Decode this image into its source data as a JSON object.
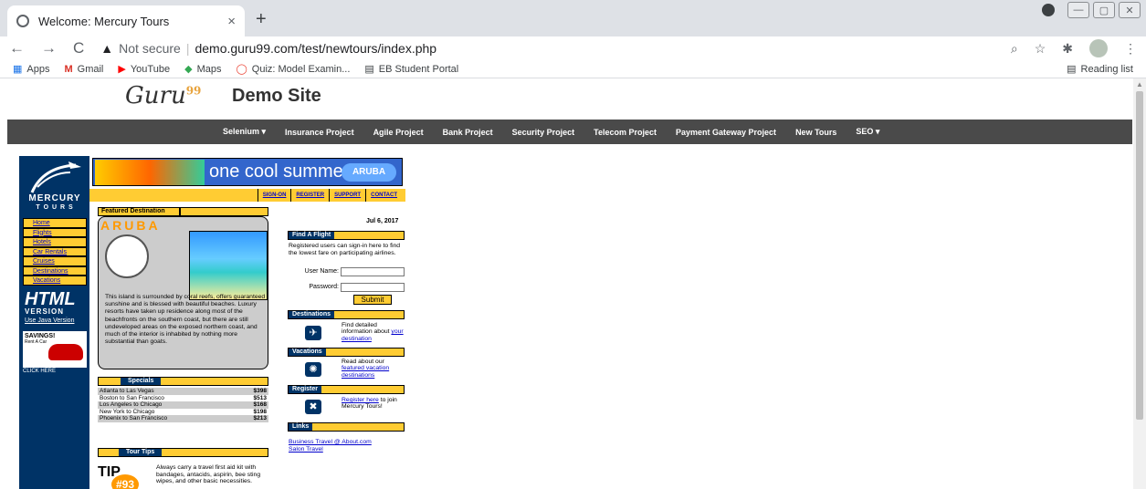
{
  "browser": {
    "tab_title": "Welcome: Mercury Tours",
    "tab_close": "×",
    "new_tab": "+",
    "address": {
      "not_secure": "Not secure",
      "separator": "|",
      "url": "demo.guru99.com/test/newtours/index.php"
    },
    "bookmarks": [
      "Apps",
      "Gmail",
      "YouTube",
      "Maps",
      "Quiz: Model Examin...",
      "EB Student Portal"
    ],
    "reading_list": "Reading list"
  },
  "site": {
    "logo": "Guru",
    "logo_sup": "99",
    "title": "Demo Site",
    "menu": [
      "Selenium ▾",
      "Insurance Project",
      "Agile Project",
      "Bank Project",
      "Security Project",
      "Telecom Project",
      "Payment Gateway Project",
      "New Tours",
      "SEO ▾"
    ]
  },
  "mercury": {
    "logo_text_1": "MERCURY",
    "logo_text_2": "T O U R S",
    "left_nav": [
      "Home",
      "Flights",
      "Hotels",
      "Car Rentals",
      "Cruises",
      "Destinations",
      "Vacations"
    ],
    "html_version_1": "HTML",
    "html_version_2": "VERSION",
    "java_link": "Use Java Version",
    "savings": "SAVINGS!",
    "savings_sub": "Rent A Car",
    "click_here": "CLICK HERE",
    "banner_text": "one cool summer",
    "banner_logo": "ARUBA",
    "top_links": [
      "SIGN-ON",
      "REGISTER",
      "SUPPORT",
      "CONTACT"
    ],
    "featured_header": "Featured Destination",
    "featured_title": "ARUBA",
    "featured_desc": "This island is surrounded by coral reefs, offers guaranteed sunshine and is blessed with beautiful beaches. Luxury resorts have taken up residence along most of the beachfronts on the southern coast, but there are still undeveloped areas on the exposed northern coast, and much of the interior is inhabited by nothing more substantial than goats.",
    "specials_header": "Specials",
    "specials": [
      {
        "route": "Atlanta to Las Vegas",
        "price": "$398"
      },
      {
        "route": "Boston to San Francisco",
        "price": "$513"
      },
      {
        "route": "Los Angeles to Chicago",
        "price": "$168"
      },
      {
        "route": "New York to Chicago",
        "price": "$198"
      },
      {
        "route": "Phoenix to San Francisco",
        "price": "$213"
      }
    ],
    "tips_header": "Tour Tips",
    "tip_logo": "TIP",
    "tip_num": "#93",
    "tip_text": "Always carry a travel first aid kit with bandages, antacids, aspirin, bee sting wipes, and other basic necessities.",
    "date": "Jul 6, 2017",
    "find_flight_header": "Find A Flight",
    "find_flight_text": "Registered users can sign-in here to find the lowest fare on participating airlines.",
    "username_label": "User Name:",
    "password_label": "Password:",
    "submit": "Submit",
    "destinations_header": "Destinations",
    "destinations_text": "Find detailed information about",
    "destinations_link": "your destination",
    "vacations_header": "Vacations",
    "vacations_text": "Read about our",
    "vacations_link": "featured vacation destinations",
    "register_header": "Register",
    "register_link": "Register here",
    "register_text": "to join Mercury Tours!",
    "links_header": "Links",
    "links": [
      "Business Travel @ About.com",
      "Salon Travel"
    ]
  }
}
